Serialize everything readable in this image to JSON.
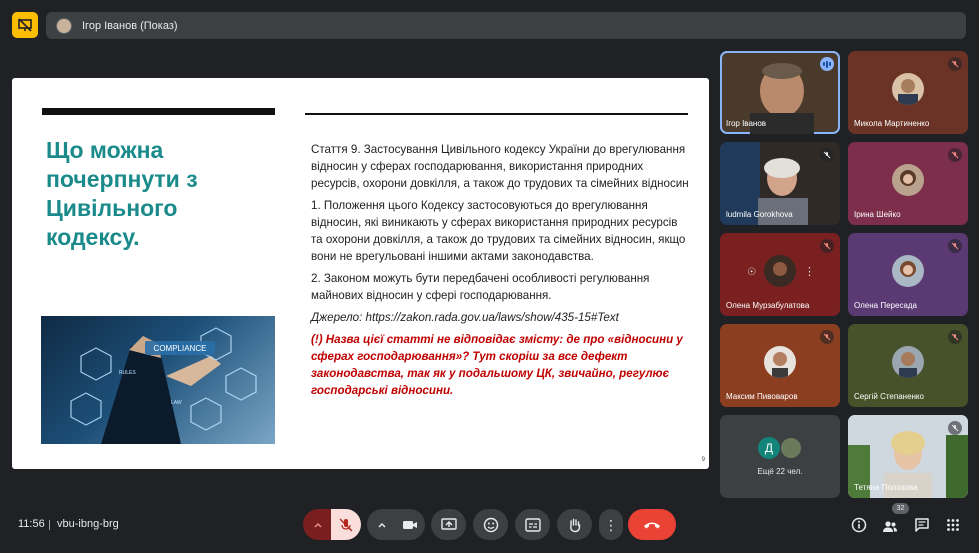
{
  "header": {
    "presenter_label": "Ігор Іванов (Показ)"
  },
  "slide": {
    "title": "Що можна почерпнути з Цивільного кодексу.",
    "image_text": "COMPLIANCE",
    "image_labels": [
      "RULES",
      "LAW"
    ],
    "paragraphs": [
      "Стаття 9. Застосування Цивільного кодексу України до врегулювання відносин у сферах господарювання, використання природних ресурсів, охорони довкілля, а також до трудових та сімейних відносин",
      "1. Положення цього Кодексу застосовуються до врегулювання відносин, які виникають у сферах використання природних ресурсів та охорони довкілля, а також до трудових та сімейних відносин, якщо вони не врегульовані іншими актами законодавства.",
      "2. Законом можуть бути передбачені особливості регулювання майнових відносин у сфері господарювання."
    ],
    "source": "Джерело: https://zakon.rada.gov.ua/laws/show/435-15#Text",
    "note": "(!) Назва цієї статті не відповідає змісту: де про «відносини у сферах господарювання»? Тут скоріш за все дефект законодавства, так як у подальшому ЦК, звичайно, регулює господарські відносини.",
    "page_number": "9"
  },
  "participants": [
    {
      "name": "Ігор Іванов",
      "bg": "#4a3a2c",
      "speaking": true
    },
    {
      "name": "Микола Мартиненко",
      "bg": "#6b3326",
      "muted": true
    },
    {
      "name": "ludmila Gorokhova",
      "bg": "#2f2a26",
      "muted": true
    },
    {
      "name": "Ірина Шейко",
      "bg": "#7c2e4a",
      "muted": true
    },
    {
      "name": "Олена Мурзабулатова",
      "bg": "#7a2020",
      "muted": true
    },
    {
      "name": "Олена Пересада",
      "bg": "#5b3a73",
      "muted": true
    },
    {
      "name": "Максим Пивоваров",
      "bg": "#8c3e21",
      "muted": true
    },
    {
      "name": "Сергій Степаненко",
      "bg": "#47512a",
      "muted": true
    },
    {
      "name": "Ещё 22 чел.",
      "bg": "#3c4043"
    },
    {
      "name": "Тетяна Полозова",
      "bg": "#c9d3dc",
      "muted": true
    }
  ],
  "more_avatar_letter": "Д",
  "bottom": {
    "time": "11:56",
    "meeting_code": "vbu-ibng-brg",
    "participants_count": "32"
  },
  "colors": {
    "background": "#202124",
    "accent": "#8ab4f8",
    "end_call": "#ea4335",
    "slide_title": "#1a8a8a",
    "note": "#c00000"
  }
}
